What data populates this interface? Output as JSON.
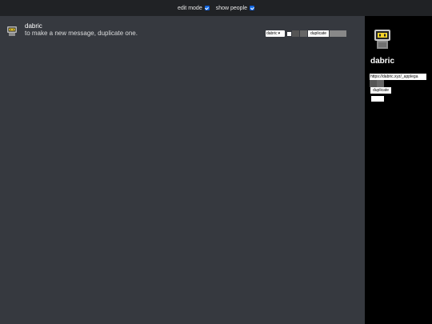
{
  "topbar": {
    "edit_mode_label": "edit mode",
    "edit_mode_checked": true,
    "show_people_label": "show people",
    "show_people_checked": true
  },
  "message": {
    "author": "dabric",
    "content": "to make a new message, duplicate one.",
    "avatar_icon": "robot-avatar-icon",
    "controls": {
      "author_select_value": "dabric",
      "duplicate_label": "duplicate"
    }
  },
  "sidebar": {
    "name": "dabric",
    "avatar_icon": "robot-avatar-icon",
    "url_value": "https://dabric.xyz/_applega",
    "duplicate_label": "duplicate"
  },
  "colors": {
    "topbar_bg": "#202225",
    "chat_bg": "#36393f",
    "sidebar_bg": "#000000",
    "avatar_yellow": "#f5d328",
    "checkbox_blue": "#1a73e8"
  }
}
